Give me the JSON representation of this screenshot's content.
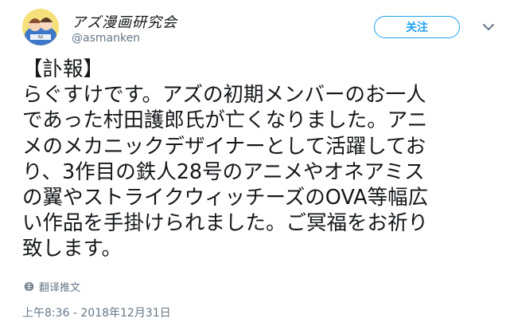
{
  "author": {
    "name": "アズ漫画研究会",
    "handle": "@asmanken"
  },
  "follow_label": "关注",
  "tweet_lines": [
    "【訃報】",
    "らぐすけです。アズの初期メンバーのお一人",
    "であった村田護郎氏が亡くなりました。アニ",
    "メのメカニックデザイナーとして活躍してお",
    "り、3作目の鉄人28号のアニメやオネアミス",
    "の翼やストライクウィッチーズのOVA等幅広",
    "い作品を手掛けられました。ご冥福をお祈り",
    "致します。"
  ],
  "translate_label": "翻译推文",
  "timestamp": "上午8:36 - 2018年12月31日",
  "icons": {
    "avatar": "avatar-image",
    "menu": "chevron-down-icon",
    "translate": "globe-icon"
  },
  "colors": {
    "accent": "#1da1f2",
    "text": "#14171a",
    "secondary": "#657786"
  }
}
